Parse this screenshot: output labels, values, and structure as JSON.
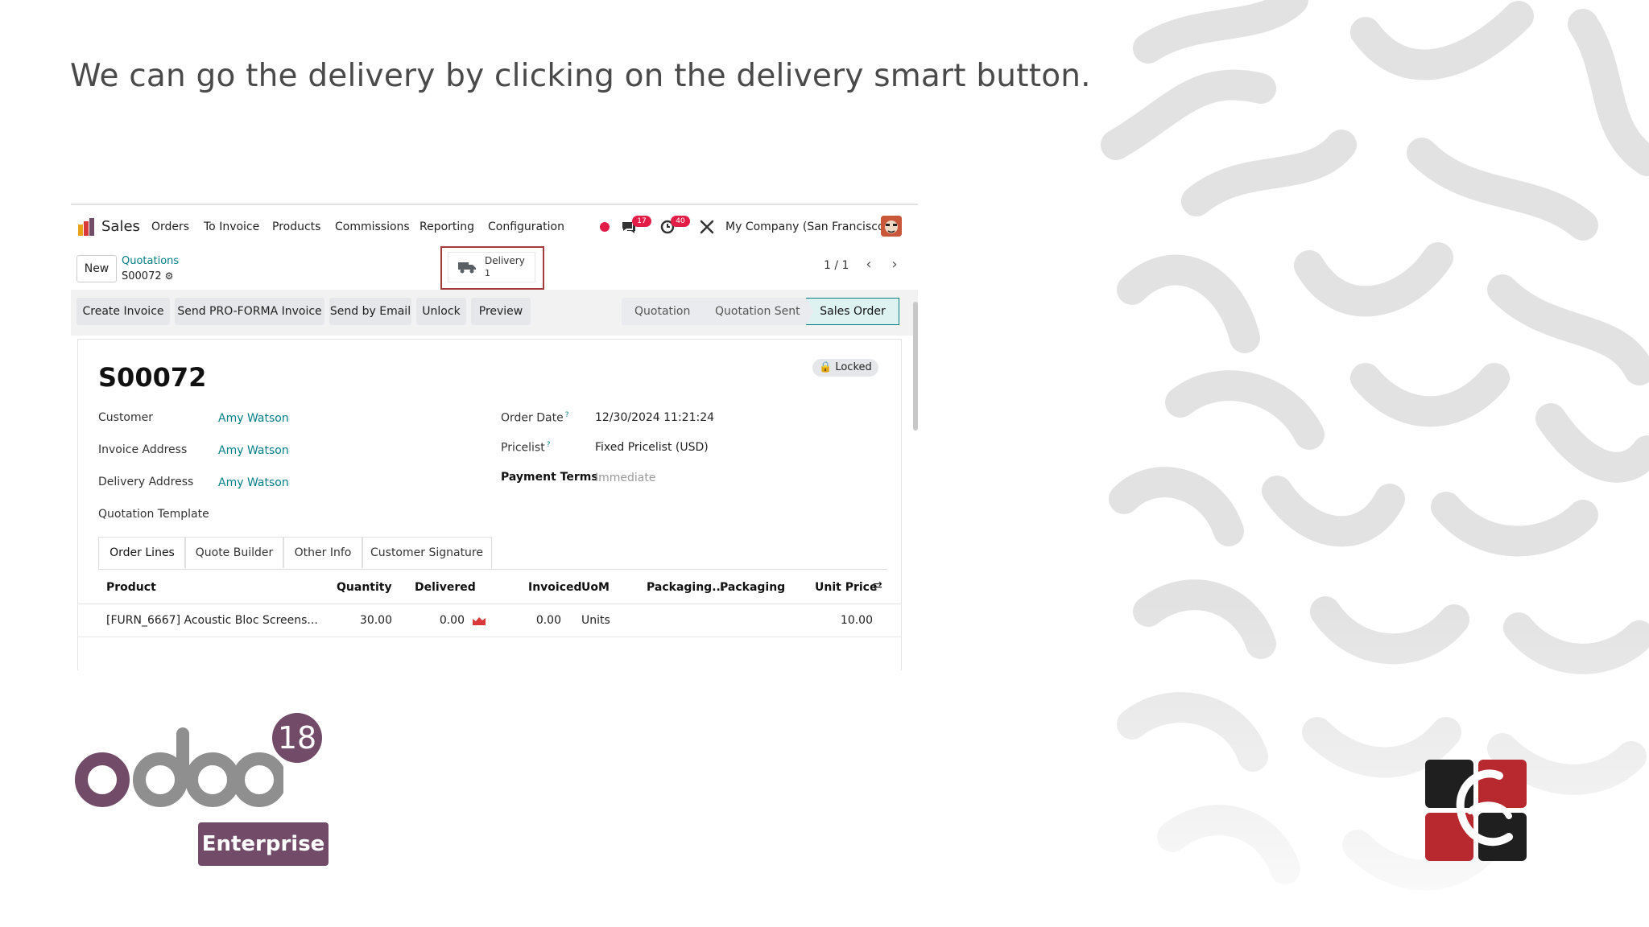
{
  "slide": {
    "title": "We can go the delivery by clicking on the delivery smart button."
  },
  "navbar": {
    "app_name": "Sales",
    "menu": [
      "Orders",
      "To Invoice",
      "Products",
      "Commissions",
      "Reporting",
      "Configuration"
    ],
    "messages_badge": "17",
    "activities_badge": "40",
    "company": "My Company (San Francisco)"
  },
  "control": {
    "new_label": "New",
    "breadcrumb_parent": "Quotations",
    "breadcrumb_current": "S00072",
    "smart_button": {
      "label": "Delivery",
      "count": "1"
    },
    "pager": "1 / 1"
  },
  "actions": {
    "buttons": [
      "Create Invoice",
      "Send PRO-FORMA Invoice",
      "Send by Email",
      "Unlock",
      "Preview"
    ],
    "statuses": [
      "Quotation",
      "Quotation Sent",
      "Sales Order"
    ]
  },
  "form": {
    "order_name": "S00072",
    "locked_label": "Locked",
    "left_fields": [
      {
        "label": "Customer",
        "value": "Amy Watson"
      },
      {
        "label": "Invoice Address",
        "value": "Amy Watson"
      },
      {
        "label": "Delivery Address",
        "value": "Amy Watson"
      },
      {
        "label": "Quotation Template",
        "value": ""
      }
    ],
    "right_fields": [
      {
        "label": "Order Date",
        "value": "12/30/2024 11:21:24",
        "help": "?"
      },
      {
        "label": "Pricelist",
        "value": "Fixed Pricelist (USD)",
        "help": "?"
      },
      {
        "label": "Payment Terms",
        "value": "Immediate"
      }
    ],
    "tabs": [
      "Order Lines",
      "Quote Builder",
      "Other Info",
      "Customer Signature"
    ]
  },
  "table": {
    "columns": [
      "Product",
      "Quantity",
      "Delivered",
      "Invoiced",
      "UoM",
      "Packaging...",
      "Packaging",
      "Unit Price"
    ],
    "rows": [
      {
        "product": "[FURN_6667] Acoustic Bloc Screens...",
        "quantity": "30.00",
        "delivered": "0.00",
        "invoiced": "0.00",
        "uom": "Units",
        "unit_price": "10.00"
      }
    ]
  },
  "branding": {
    "version": "18",
    "edition": "Enterprise"
  },
  "colors": {
    "odoo_purple": "#714b67",
    "link_teal": "#017e84",
    "highlight_red": "#a33a3a",
    "badge_red": "#e11d48"
  }
}
